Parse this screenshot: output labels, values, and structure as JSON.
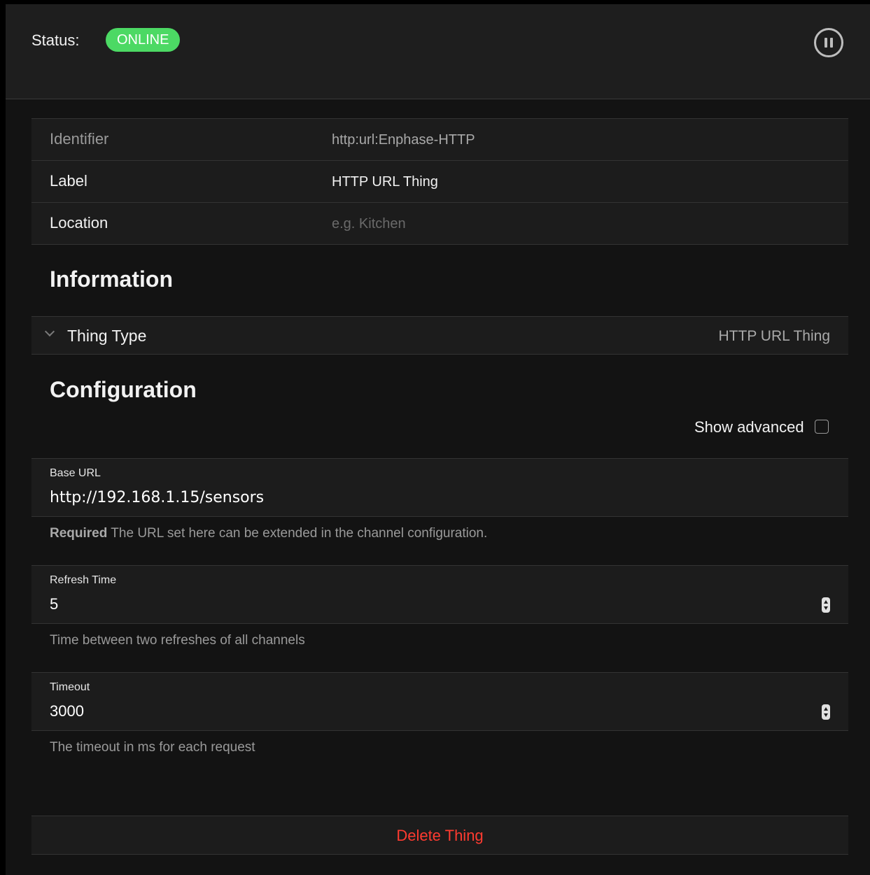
{
  "status": {
    "label": "Status:",
    "badge": "ONLINE",
    "badge_color": "#4cd964"
  },
  "pause_icon": "pause-circle-icon",
  "properties": [
    {
      "label": "Identifier",
      "value": "http:url:Enphase-HTTP"
    },
    {
      "label": "Label",
      "value": "HTTP URL Thing"
    },
    {
      "label": "Location",
      "placeholder": "e.g. Kitchen",
      "value": ""
    }
  ],
  "information": {
    "title": "Information",
    "thing_type_label": "Thing Type",
    "thing_type_value": "HTTP URL Thing"
  },
  "configuration": {
    "title": "Configuration",
    "show_advanced": "Show advanced",
    "show_advanced_checked": false,
    "fields": [
      {
        "label": "Base URL",
        "value": "http://192.168.1.15/sensors",
        "help_required": "Required",
        "help": "The URL set here can be extended in the channel configuration."
      },
      {
        "label": "Refresh Time",
        "value": "5",
        "help": "Time between two refreshes of all channels"
      },
      {
        "label": "Timeout",
        "value": "3000",
        "help": "The timeout in ms for each request"
      }
    ]
  },
  "delete_label": "Delete Thing",
  "colors": {
    "danger": "#ff3b30",
    "background": "#131313",
    "surface": "#1c1c1c"
  }
}
